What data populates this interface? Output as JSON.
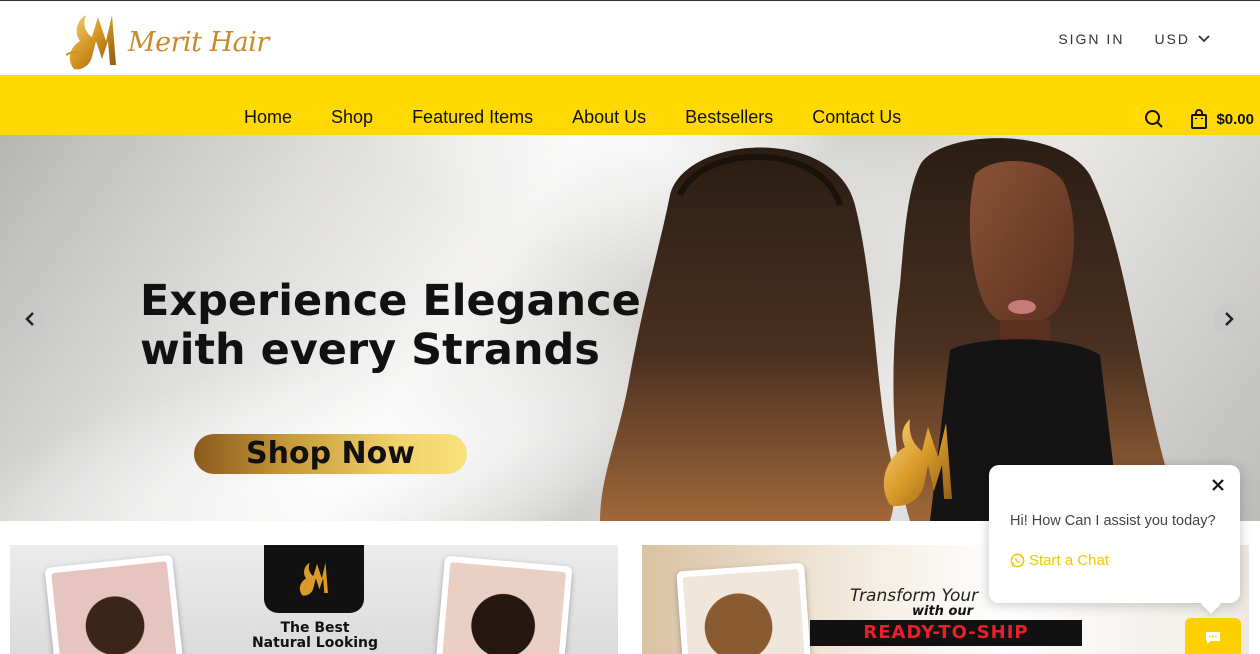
{
  "header": {
    "logo_text": "Merit Hair",
    "sign_in": "SIGN IN",
    "currency": "USD"
  },
  "nav": {
    "items": [
      "Home",
      "Shop",
      "Featured Items",
      "About Us",
      "Bestsellers",
      "Contact Us"
    ],
    "cart_total": "$0.00"
  },
  "hero": {
    "title_line1": "Experience Elegance",
    "title_line2": "with every Strands",
    "cta": "Shop Now"
  },
  "promos": {
    "left_caption_line1": "The Best",
    "left_caption_line2": "Natural Looking",
    "right_line1": "Transform Your",
    "right_line2": "with our",
    "right_badge": "READY-TO-SHIP"
  },
  "chat": {
    "greeting": "Hi! How Can I assist you today?",
    "start": "Start a Chat"
  },
  "colors": {
    "nav_bg": "#ffd900",
    "brand_gold": "#c88a2a",
    "chat_accent": "#f0c800"
  },
  "icons": [
    "logo-mark-icon",
    "chevron-down-icon",
    "search-icon",
    "shopping-bag-icon",
    "chevron-left-icon",
    "chevron-right-icon",
    "close-icon",
    "whatsapp-icon",
    "chat-bubble-icon"
  ]
}
